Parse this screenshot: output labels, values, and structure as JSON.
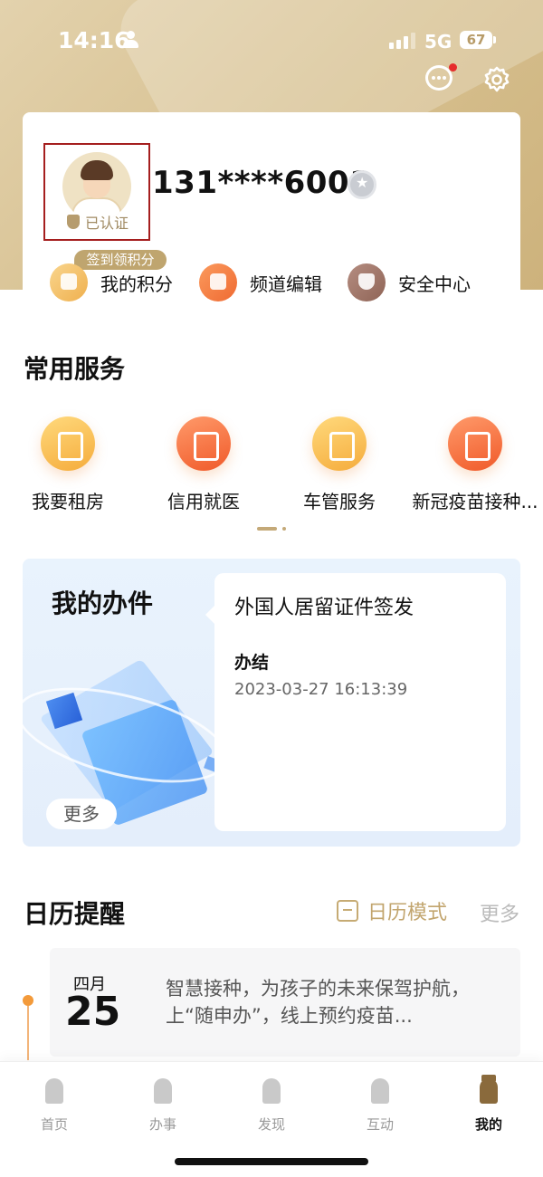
{
  "status_bar": {
    "time": "14:16",
    "network": "5G",
    "battery": "67"
  },
  "header": {
    "message_icon": "chat-bubble-icon",
    "settings_icon": "gear-icon",
    "has_unread": true
  },
  "profile": {
    "phone": "131****6001",
    "verified_label": "已认证",
    "points_tag": "签到领积分",
    "quick_links": [
      {
        "label": "我的积分",
        "icon": "points-icon"
      },
      {
        "label": "频道编辑",
        "icon": "channel-edit-icon"
      },
      {
        "label": "安全中心",
        "icon": "shield-icon"
      }
    ]
  },
  "services": {
    "title": "常用服务",
    "items": [
      {
        "label": "我要租房",
        "icon": "rent-document-icon"
      },
      {
        "label": "信用就医",
        "icon": "medical-phone-icon"
      },
      {
        "label": "车管服务",
        "icon": "car-icon"
      },
      {
        "label": "新冠疫苗接种...",
        "icon": "syringe-icon"
      }
    ]
  },
  "tasks": {
    "title": "我的办件",
    "more_label": "更多",
    "latest": {
      "name": "外国人居留证件签发",
      "status": "办结",
      "time": "2023-03-27 16:13:39"
    }
  },
  "calendar": {
    "title": "日历提醒",
    "mode_label": "日历模式",
    "more_label": "更多",
    "event": {
      "month": "四月",
      "day": "25",
      "text": "智慧接种，为孩子的未来保驾护航，上“随申办”，线上预约疫苗..."
    }
  },
  "tabbar": {
    "items": [
      {
        "label": "首页",
        "icon": "tower-icon",
        "active": false
      },
      {
        "label": "办事",
        "icon": "pen-icon",
        "active": false
      },
      {
        "label": "发现",
        "icon": "gate-icon",
        "active": false
      },
      {
        "label": "互动",
        "icon": "flower-icon",
        "active": false
      },
      {
        "label": "我的",
        "icon": "person-hat-icon",
        "active": true
      }
    ]
  },
  "colors": {
    "accent_gold": "#c2a56e",
    "badge_red": "#e62c2c",
    "timeline_orange": "#f39a3a"
  }
}
